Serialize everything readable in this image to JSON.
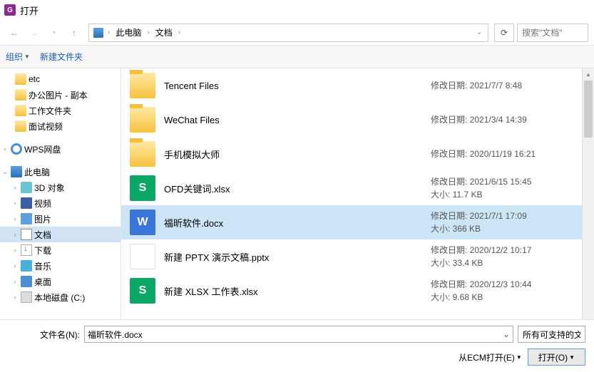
{
  "window": {
    "title": "打开"
  },
  "nav": {
    "crumbs": [
      "此电脑",
      "文档"
    ]
  },
  "search": {
    "placeholder": "搜索\"文档\""
  },
  "toolbar": {
    "organize": "组织",
    "newfolder": "新建文件夹"
  },
  "sidebar": {
    "group1": [
      {
        "label": "etc",
        "icon": "folder"
      },
      {
        "label": "办公图片 - 副本",
        "icon": "folder"
      },
      {
        "label": "工作文件夹",
        "icon": "folder"
      },
      {
        "label": "面试视频",
        "icon": "folder"
      }
    ],
    "wps": {
      "label": "WPS网盘"
    },
    "thispc": {
      "label": "此电脑"
    },
    "pcitems": [
      {
        "label": "3D 对象",
        "icon": "cube"
      },
      {
        "label": "视频",
        "icon": "video"
      },
      {
        "label": "图片",
        "icon": "pic"
      },
      {
        "label": "文档",
        "icon": "doc",
        "selected": true
      },
      {
        "label": "下载",
        "icon": "dl"
      },
      {
        "label": "音乐",
        "icon": "music"
      },
      {
        "label": "桌面",
        "icon": "desk"
      },
      {
        "label": "本地磁盘 (C:)",
        "icon": "disk"
      }
    ]
  },
  "files": [
    {
      "name": "Tencent Files",
      "type": "folder",
      "dateLabel": "修改日期:",
      "date": "2021/7/7 8:48"
    },
    {
      "name": "WeChat Files",
      "type": "folder",
      "dateLabel": "修改日期:",
      "date": "2021/3/4 14:39"
    },
    {
      "name": "手机模拟大师",
      "type": "folder",
      "dateLabel": "修改日期:",
      "date": "2020/11/19 16:21"
    },
    {
      "name": "OFD关键词.xlsx",
      "type": "sheet",
      "glyph": "S",
      "dateLabel": "修改日期:",
      "date": "2021/6/15 15:45",
      "sizeLabel": "大小:",
      "size": "11.7 KB"
    },
    {
      "name": "福昕软件.docx",
      "type": "docx",
      "glyph": "W",
      "dateLabel": "修改日期:",
      "date": "2021/7/1 17:09",
      "sizeLabel": "大小:",
      "size": "366 KB",
      "selected": true
    },
    {
      "name": "新建 PPTX 演示文稿.pptx",
      "type": "pptx",
      "glyph": "",
      "dateLabel": "修改日期:",
      "date": "2020/12/2 10:17",
      "sizeLabel": "大小:",
      "size": "33.4 KB"
    },
    {
      "name": "新建 XLSX 工作表.xlsx",
      "type": "sheet",
      "glyph": "S",
      "dateLabel": "修改日期:",
      "date": "2020/12/3 10:44",
      "sizeLabel": "大小:",
      "size": "9.68 KB"
    }
  ],
  "footer": {
    "fileLabel": "文件名(N):",
    "fileValue": "福昕软件.docx",
    "filter": "所有可支持的文件",
    "ecm": "从ECM打开(E)",
    "open": "打开(O)"
  }
}
